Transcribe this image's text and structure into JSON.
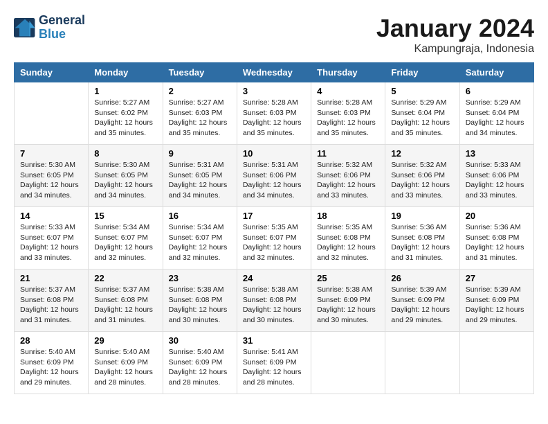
{
  "logo": {
    "line1": "General",
    "line2": "Blue"
  },
  "title": "January 2024",
  "location": "Kampungraja, Indonesia",
  "headers": [
    "Sunday",
    "Monday",
    "Tuesday",
    "Wednesday",
    "Thursday",
    "Friday",
    "Saturday"
  ],
  "weeks": [
    [
      {
        "day": "",
        "info": ""
      },
      {
        "day": "1",
        "info": "Sunrise: 5:27 AM\nSunset: 6:02 PM\nDaylight: 12 hours\nand 35 minutes."
      },
      {
        "day": "2",
        "info": "Sunrise: 5:27 AM\nSunset: 6:03 PM\nDaylight: 12 hours\nand 35 minutes."
      },
      {
        "day": "3",
        "info": "Sunrise: 5:28 AM\nSunset: 6:03 PM\nDaylight: 12 hours\nand 35 minutes."
      },
      {
        "day": "4",
        "info": "Sunrise: 5:28 AM\nSunset: 6:03 PM\nDaylight: 12 hours\nand 35 minutes."
      },
      {
        "day": "5",
        "info": "Sunrise: 5:29 AM\nSunset: 6:04 PM\nDaylight: 12 hours\nand 35 minutes."
      },
      {
        "day": "6",
        "info": "Sunrise: 5:29 AM\nSunset: 6:04 PM\nDaylight: 12 hours\nand 34 minutes."
      }
    ],
    [
      {
        "day": "7",
        "info": "Sunrise: 5:30 AM\nSunset: 6:05 PM\nDaylight: 12 hours\nand 34 minutes."
      },
      {
        "day": "8",
        "info": "Sunrise: 5:30 AM\nSunset: 6:05 PM\nDaylight: 12 hours\nand 34 minutes."
      },
      {
        "day": "9",
        "info": "Sunrise: 5:31 AM\nSunset: 6:05 PM\nDaylight: 12 hours\nand 34 minutes."
      },
      {
        "day": "10",
        "info": "Sunrise: 5:31 AM\nSunset: 6:06 PM\nDaylight: 12 hours\nand 34 minutes."
      },
      {
        "day": "11",
        "info": "Sunrise: 5:32 AM\nSunset: 6:06 PM\nDaylight: 12 hours\nand 33 minutes."
      },
      {
        "day": "12",
        "info": "Sunrise: 5:32 AM\nSunset: 6:06 PM\nDaylight: 12 hours\nand 33 minutes."
      },
      {
        "day": "13",
        "info": "Sunrise: 5:33 AM\nSunset: 6:06 PM\nDaylight: 12 hours\nand 33 minutes."
      }
    ],
    [
      {
        "day": "14",
        "info": "Sunrise: 5:33 AM\nSunset: 6:07 PM\nDaylight: 12 hours\nand 33 minutes."
      },
      {
        "day": "15",
        "info": "Sunrise: 5:34 AM\nSunset: 6:07 PM\nDaylight: 12 hours\nand 32 minutes."
      },
      {
        "day": "16",
        "info": "Sunrise: 5:34 AM\nSunset: 6:07 PM\nDaylight: 12 hours\nand 32 minutes."
      },
      {
        "day": "17",
        "info": "Sunrise: 5:35 AM\nSunset: 6:07 PM\nDaylight: 12 hours\nand 32 minutes."
      },
      {
        "day": "18",
        "info": "Sunrise: 5:35 AM\nSunset: 6:08 PM\nDaylight: 12 hours\nand 32 minutes."
      },
      {
        "day": "19",
        "info": "Sunrise: 5:36 AM\nSunset: 6:08 PM\nDaylight: 12 hours\nand 31 minutes."
      },
      {
        "day": "20",
        "info": "Sunrise: 5:36 AM\nSunset: 6:08 PM\nDaylight: 12 hours\nand 31 minutes."
      }
    ],
    [
      {
        "day": "21",
        "info": "Sunrise: 5:37 AM\nSunset: 6:08 PM\nDaylight: 12 hours\nand 31 minutes."
      },
      {
        "day": "22",
        "info": "Sunrise: 5:37 AM\nSunset: 6:08 PM\nDaylight: 12 hours\nand 31 minutes."
      },
      {
        "day": "23",
        "info": "Sunrise: 5:38 AM\nSunset: 6:08 PM\nDaylight: 12 hours\nand 30 minutes."
      },
      {
        "day": "24",
        "info": "Sunrise: 5:38 AM\nSunset: 6:08 PM\nDaylight: 12 hours\nand 30 minutes."
      },
      {
        "day": "25",
        "info": "Sunrise: 5:38 AM\nSunset: 6:09 PM\nDaylight: 12 hours\nand 30 minutes."
      },
      {
        "day": "26",
        "info": "Sunrise: 5:39 AM\nSunset: 6:09 PM\nDaylight: 12 hours\nand 29 minutes."
      },
      {
        "day": "27",
        "info": "Sunrise: 5:39 AM\nSunset: 6:09 PM\nDaylight: 12 hours\nand 29 minutes."
      }
    ],
    [
      {
        "day": "28",
        "info": "Sunrise: 5:40 AM\nSunset: 6:09 PM\nDaylight: 12 hours\nand 29 minutes."
      },
      {
        "day": "29",
        "info": "Sunrise: 5:40 AM\nSunset: 6:09 PM\nDaylight: 12 hours\nand 28 minutes."
      },
      {
        "day": "30",
        "info": "Sunrise: 5:40 AM\nSunset: 6:09 PM\nDaylight: 12 hours\nand 28 minutes."
      },
      {
        "day": "31",
        "info": "Sunrise: 5:41 AM\nSunset: 6:09 PM\nDaylight: 12 hours\nand 28 minutes."
      },
      {
        "day": "",
        "info": ""
      },
      {
        "day": "",
        "info": ""
      },
      {
        "day": "",
        "info": ""
      }
    ]
  ]
}
